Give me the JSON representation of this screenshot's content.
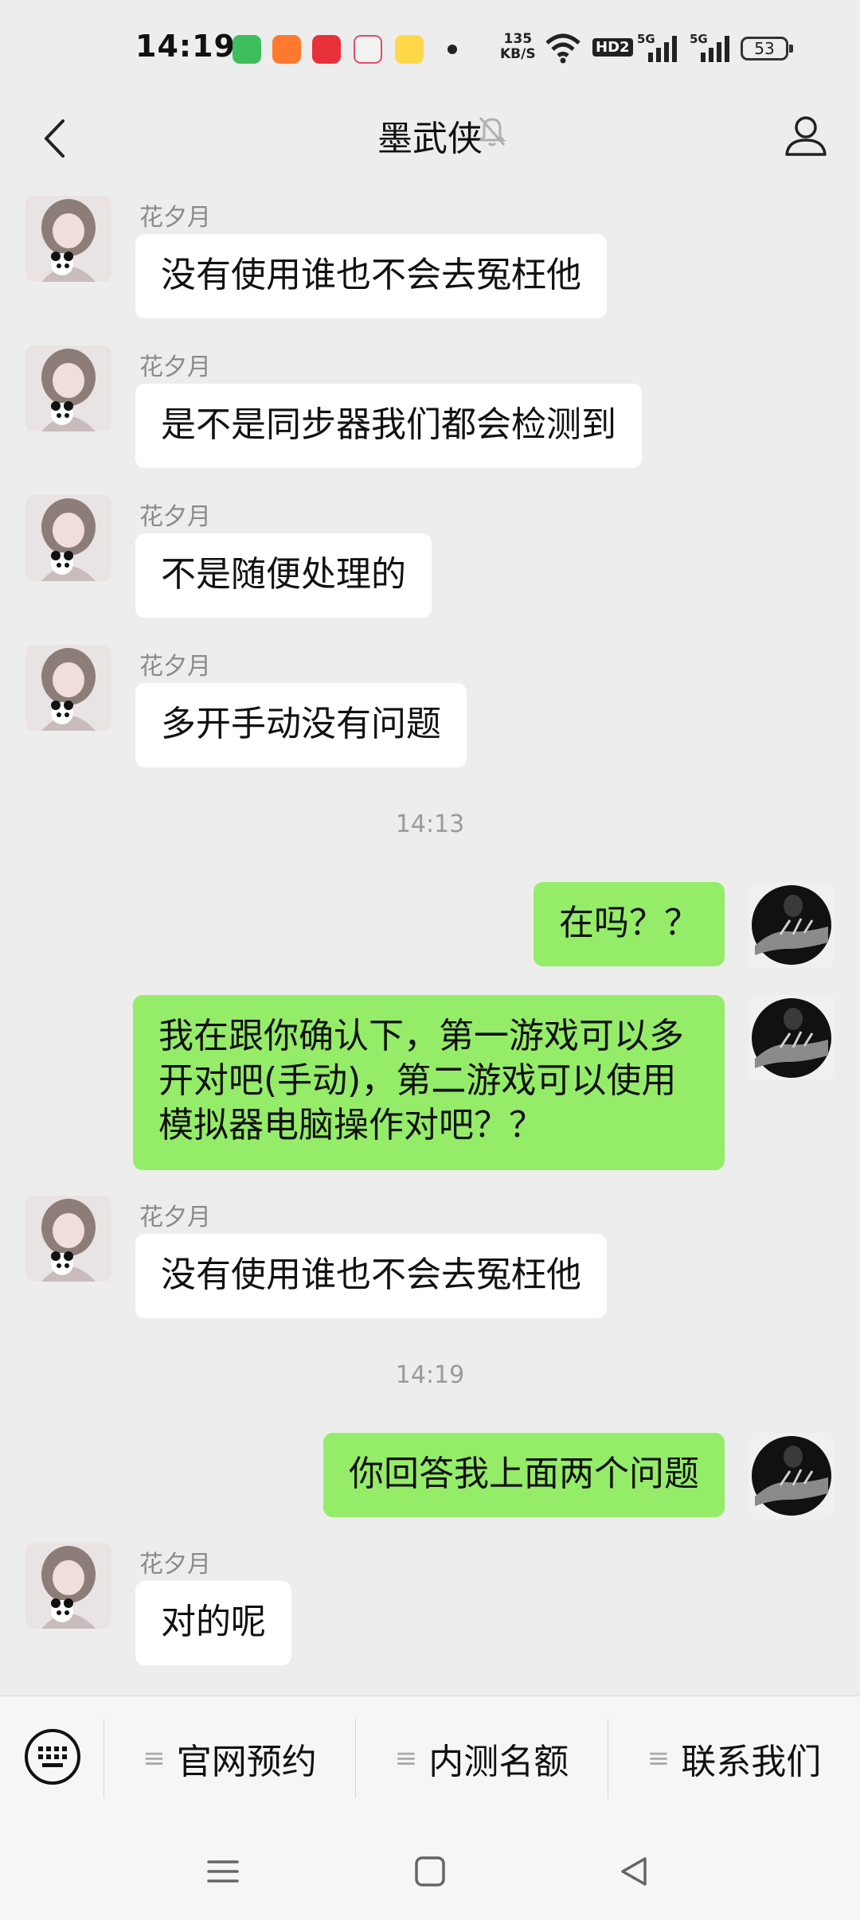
{
  "status_bar": {
    "time": "14:19",
    "net_speed_value": "135",
    "net_speed_unit": "KB/S",
    "hd_label": "HD2",
    "signal1_label": "5G",
    "signal2_label": "5G",
    "battery": "53"
  },
  "header": {
    "title": "墨武侠"
  },
  "messages": [
    {
      "sender": "花夕月",
      "text": "没有使用谁也不会去冤枉他"
    },
    {
      "sender": "花夕月",
      "text": "是不是同步器我们都会检测到"
    },
    {
      "sender": "花夕月",
      "text": "不是随便处理的"
    },
    {
      "sender": "花夕月",
      "text": "多开手动没有问题"
    },
    {
      "timestamp": "14:13"
    },
    {
      "text": "在吗？？"
    },
    {
      "text": "我在跟你确认下，第一游戏可以多开对吧(手动)，第二游戏可以使用模拟器电脑操作对吧？？"
    },
    {
      "sender": "花夕月",
      "text": "没有使用谁也不会去冤枉他"
    },
    {
      "timestamp": "14:19"
    },
    {
      "text": "你回答我上面两个问题"
    },
    {
      "sender": "花夕月",
      "text": "对的呢"
    }
  ],
  "menu": {
    "items": [
      "官网预约",
      "内测名额",
      "联系我们"
    ]
  },
  "colors": {
    "background": "#ededed",
    "outgoing_bubble": "#95ec69",
    "incoming_bubble": "#ffffff",
    "menu_bar": "#f6f6f6"
  }
}
